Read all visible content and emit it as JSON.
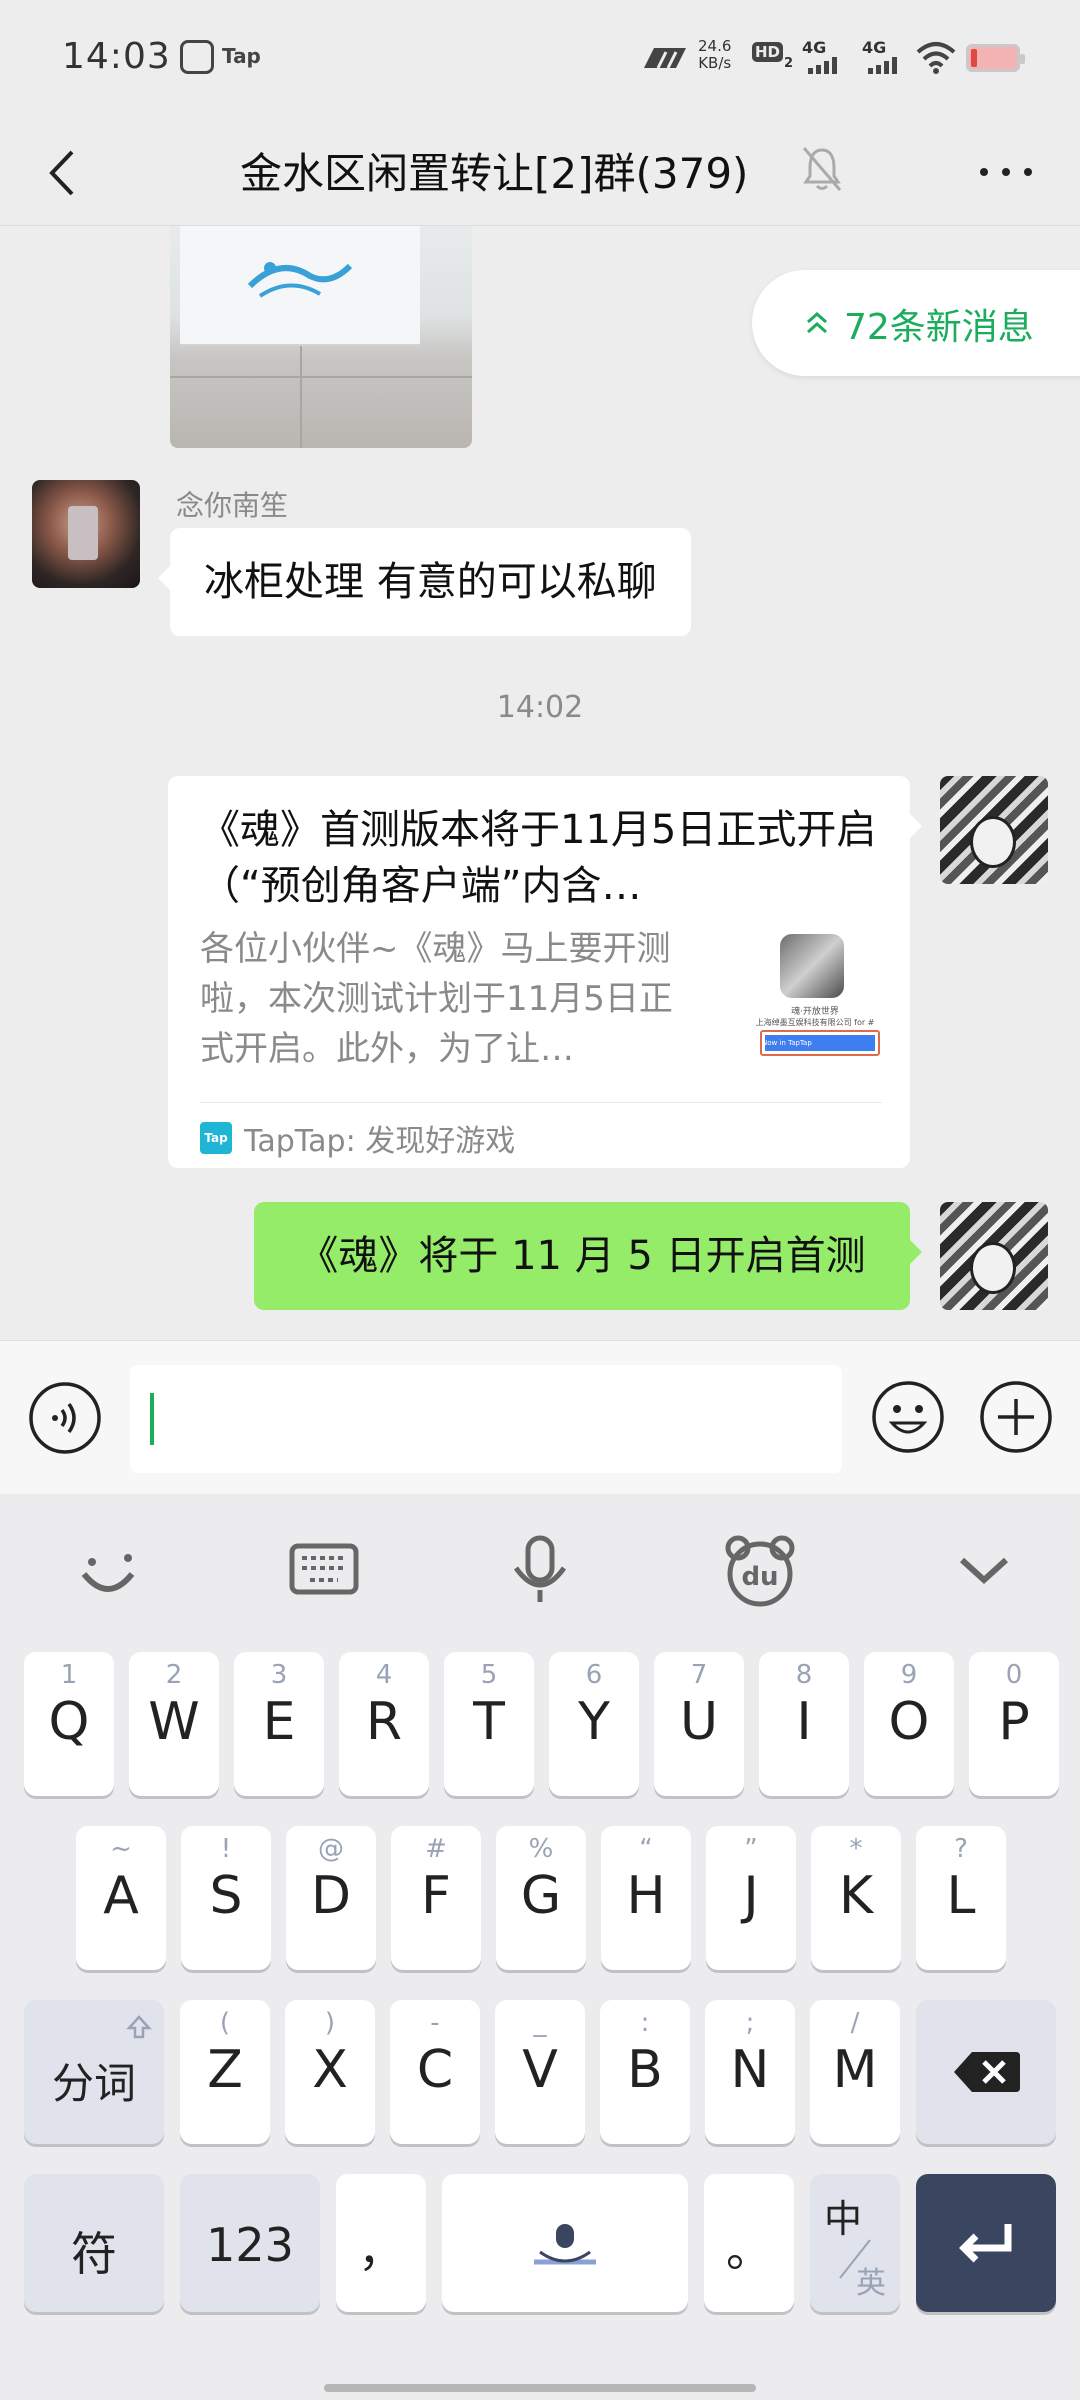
{
  "status_bar": {
    "time": "14:03",
    "app_badge": "Tap",
    "net_speed_value": "24.6",
    "net_speed_unit": "KB/s",
    "hd_label": "HD",
    "hd_sub": "2",
    "signal_1": "4G",
    "signal_2": "4G"
  },
  "nav": {
    "title": "金水区闲置转让[2]群(379)"
  },
  "chat": {
    "new_messages_pill": "72条新消息",
    "messages": [
      {
        "sender": "念你南笙",
        "text": "冰柜处理  有意的可以私聊"
      },
      {
        "timestamp": "14:02"
      },
      {
        "type": "link_card",
        "title": "《魂》首测版本将于11月5日正式开启（“预创角客户端”内含…",
        "description": "各位小伙伴~《魂》马上要开测啦，本次测试计划于11月5日正式开启。此外，为了让…",
        "thumb_line1": "魂·开放世界",
        "thumb_line2": "上海绰墨互娱科技有限公司 for #",
        "thumb_button": "Now in TapTap",
        "source_icon_text": "Tap",
        "source": "TapTap: 发现好游戏"
      },
      {
        "type": "text_self",
        "text": "《魂》将于 11 月 5 日开启首测"
      }
    ]
  },
  "input": {
    "placeholder": ""
  },
  "keyboard": {
    "row1": [
      {
        "hint": "1",
        "label": "Q"
      },
      {
        "hint": "2",
        "label": "W"
      },
      {
        "hint": "3",
        "label": "E"
      },
      {
        "hint": "4",
        "label": "R"
      },
      {
        "hint": "5",
        "label": "T"
      },
      {
        "hint": "6",
        "label": "Y"
      },
      {
        "hint": "7",
        "label": "U"
      },
      {
        "hint": "8",
        "label": "I"
      },
      {
        "hint": "9",
        "label": "O"
      },
      {
        "hint": "0",
        "label": "P"
      }
    ],
    "row2": [
      {
        "hint": "~",
        "label": "A"
      },
      {
        "hint": "!",
        "label": "S"
      },
      {
        "hint": "@",
        "label": "D"
      },
      {
        "hint": "#",
        "label": "F"
      },
      {
        "hint": "%",
        "label": "G"
      },
      {
        "hint": "“",
        "label": "H"
      },
      {
        "hint": "”",
        "label": "J"
      },
      {
        "hint": "*",
        "label": "K"
      },
      {
        "hint": "?",
        "label": "L"
      }
    ],
    "row3": [
      {
        "hint": "(",
        "label": "Z"
      },
      {
        "hint": ")",
        "label": "X"
      },
      {
        "hint": "-",
        "label": "C"
      },
      {
        "hint": "_",
        "label": "V"
      },
      {
        "hint": ":",
        "label": "B"
      },
      {
        "hint": ";",
        "label": "N"
      },
      {
        "hint": "/",
        "label": "M"
      }
    ],
    "segment_key": "分词",
    "symbol_key": "符",
    "number_key": "123",
    "comma_key": "，",
    "period_key": "。",
    "lang_key_main": "中",
    "lang_key_sub": "英"
  }
}
